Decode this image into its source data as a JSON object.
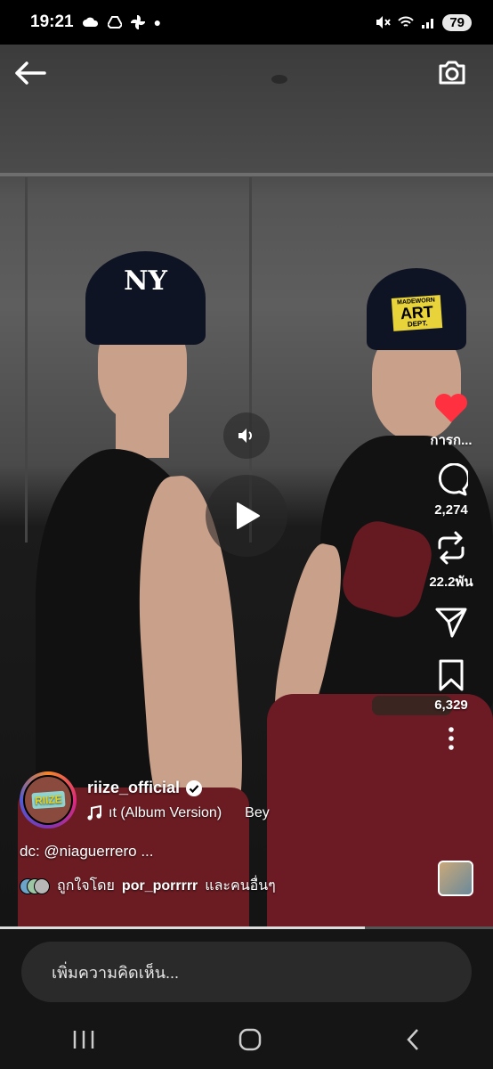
{
  "status": {
    "time": "19:21",
    "battery": "79"
  },
  "rail": {
    "like_label": "การก...",
    "comments_count": "2,274",
    "reposts_count": "22.2พัน",
    "saves_count": "6,329"
  },
  "post": {
    "avatar_text": "RIIZE",
    "username": "riize_official",
    "music": "ıt (Album Version)",
    "music_artist": "Bey",
    "description": "dc: @niaguerrero ...",
    "liked_prefix": "ถูกใจโดย",
    "liked_user": "por_porrrrr",
    "liked_suffix": "และคนอื่นๆ"
  },
  "video_caps": {
    "left_cap": "NY",
    "right_cap_line1": "MADEWORN",
    "right_cap_line2": "ART",
    "right_cap_line3": "DEPT."
  },
  "progress": 0.74,
  "comment_placeholder": "เพิ่มความคิดเห็น...",
  "colors": {
    "like": "#ff3040",
    "background": "#000000"
  }
}
